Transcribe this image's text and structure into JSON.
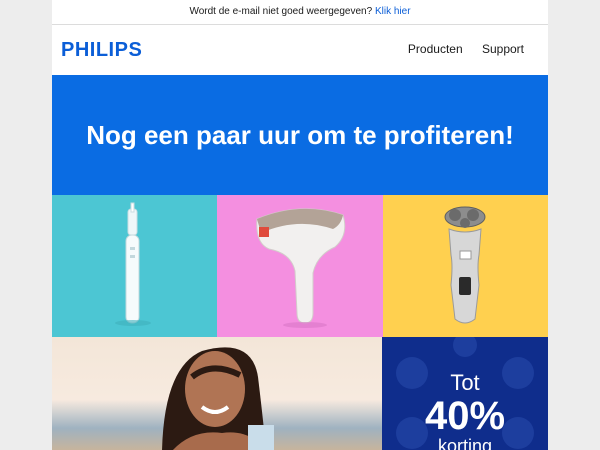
{
  "preheader": {
    "text": "Wordt de e-mail niet goed weergegeven?",
    "link": "Klik hier"
  },
  "header": {
    "logo": "PHILIPS",
    "nav": [
      "Producten",
      "Support"
    ]
  },
  "hero": {
    "headline": "Nog een paar uur om te profiteren!"
  },
  "products": {
    "tiles": [
      {
        "item": "electric-toothbrush",
        "bg": "#4cc6d3"
      },
      {
        "item": "ipl-hair-removal-device",
        "bg": "#f48fe0"
      },
      {
        "item": "electric-shaver",
        "bg": "#ffd04f"
      }
    ]
  },
  "promo": {
    "line1": "Tot",
    "line2": "40%",
    "line3": "korting",
    "bg": "#0f2d8c"
  },
  "colors": {
    "brand_blue": "#0b5ed7",
    "hero_blue": "#0a6ce3"
  }
}
